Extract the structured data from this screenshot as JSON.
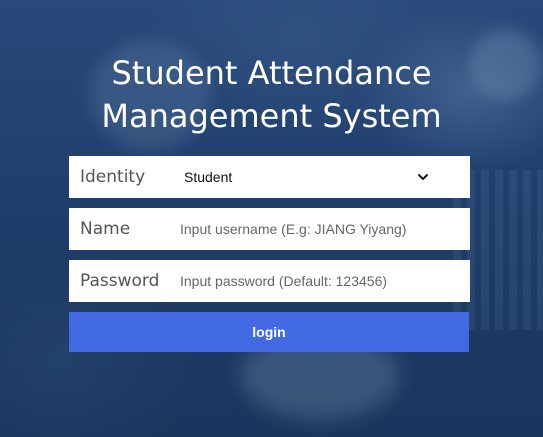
{
  "title": {
    "line1": "Student Attendance",
    "line2": "Management System"
  },
  "form": {
    "identity": {
      "label": "Identity",
      "selected": "Student",
      "icon": "chevron-down-icon"
    },
    "name": {
      "label": "Name",
      "value": "",
      "placeholder": "Input username (E.g: JIANG Yiyang)"
    },
    "password": {
      "label": "Password",
      "value": "",
      "placeholder": "Input password (Default: 123456)"
    },
    "login_label": "login"
  },
  "colors": {
    "button": "#4169e1",
    "background": "#1f3d68",
    "field": "#ffffff"
  }
}
